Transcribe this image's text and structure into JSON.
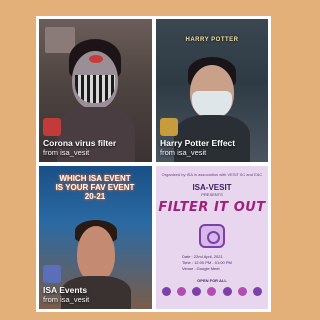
{
  "tiles": [
    {
      "title": "Corona virus filter",
      "from": "from isa_vesit"
    },
    {
      "title": "Harry Potter Effect",
      "from": "from isa_vesit",
      "overlay_text": "HARRY POTTER"
    },
    {
      "title": "ISA Events",
      "from": "from isa_vesit",
      "overlay_text": "WHICH ISA EVENT IS YOUR FAV EVENT 20-21"
    },
    {
      "org_text": "Organized by ISA in association with VESIT IIC and E&C",
      "brand": "ISA-VESIT",
      "presents": "PRESENTS",
      "headline": "FILTER IT OUT",
      "date": "Date : 22nd April, 2021",
      "time": "Time : 12:00 PM - 01:00 PM",
      "venue": "Venue : Google Meet",
      "open": "OPEN FOR ALL"
    }
  ],
  "colors": {
    "background": "#e4b07a",
    "frame": "#ffffff",
    "poster_bg": "#e8d6ee",
    "poster_accent": "#a0207a"
  }
}
